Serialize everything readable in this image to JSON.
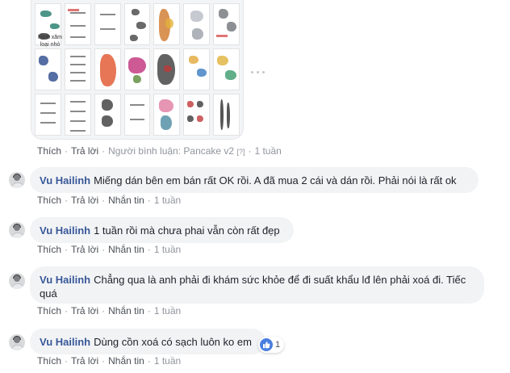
{
  "attachment": {
    "caption": "Hình xăm\nloại nhỏ"
  },
  "action_labels": {
    "like": "Thích",
    "reply": "Trả lời",
    "message": "Nhắn tin",
    "separator": "·"
  },
  "reply_meta": {
    "responder": "Người bình luận: Pancake v2",
    "flag": "[?]",
    "time": "1 tuần"
  },
  "comments": [
    {
      "author": "Vu Hailinh",
      "text": "Miếng dán bên em bán rất OK rồi. A đã mua 2 cái và dán rồi. Phải nói là rất ok",
      "time": "1 tuần"
    },
    {
      "author": "Vu Hailinh",
      "text": "1 tuần rồi mà chưa phai vẫn còn rất đẹp",
      "time": "1 tuần"
    },
    {
      "author": "Vu Hailinh",
      "text": "Chẳng qua là anh phải đi khám sức khỏe để đi suất khẩu lđ lên phải xoá đi. Tiếc quá",
      "time": "1 tuần"
    },
    {
      "author": "Vu Hailinh",
      "text": "Dùng cồn xoá có sạch luôn ko em",
      "time": "1 tuần",
      "reaction_count": "1"
    }
  ],
  "colors": {
    "author_link": "#385898",
    "bubble_bg": "#f2f3f5",
    "meta_text": "#90949c",
    "like_icon": "#4a7fe0"
  }
}
